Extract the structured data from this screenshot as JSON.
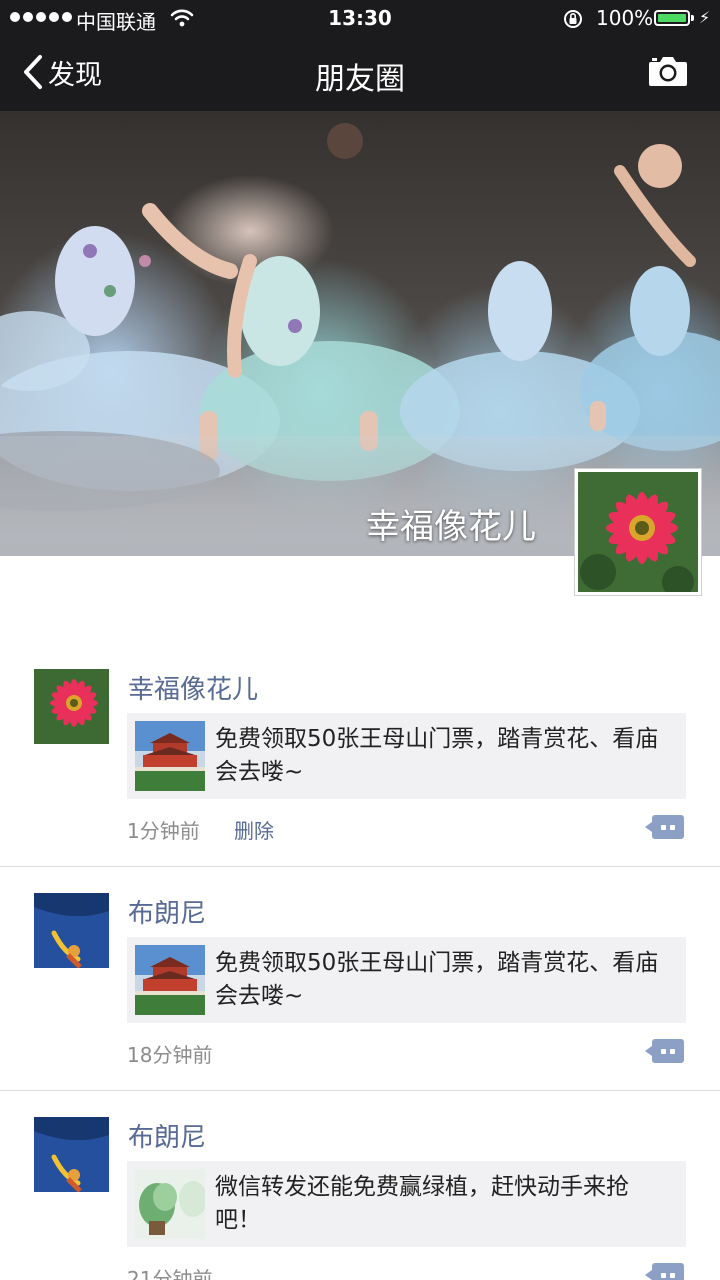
{
  "status_bar": {
    "carrier": "中国联通",
    "time": "13:30",
    "battery": "100%"
  },
  "nav": {
    "back_label": "发现",
    "title": "朋友圈"
  },
  "profile": {
    "name": "幸福像花儿"
  },
  "posts": [
    {
      "author": "幸福像花儿",
      "share_text": "免费领取50张王母山门票，踏青赏花、看庙会去喽~",
      "time": "1分钟前",
      "delete_label": "删除"
    },
    {
      "author": "布朗尼",
      "share_text": "免费领取50张王母山门票，踏青赏花、看庙会去喽~",
      "time": "18分钟前"
    },
    {
      "author": "布朗尼",
      "share_text": "微信转发还能免费赢绿植，赶快动手来抢吧！",
      "time": "21分钟前"
    }
  ],
  "colors": {
    "nav_bg": "#1b1b1d",
    "link_blue": "#576b95",
    "card_bg": "#f1f1f3",
    "battery_green": "#4cd964"
  },
  "icons": [
    "signal-dots-icon",
    "wifi-icon",
    "lock-rotation-icon",
    "battery-icon",
    "back-chevron-icon",
    "camera-icon",
    "comment-icon"
  ]
}
